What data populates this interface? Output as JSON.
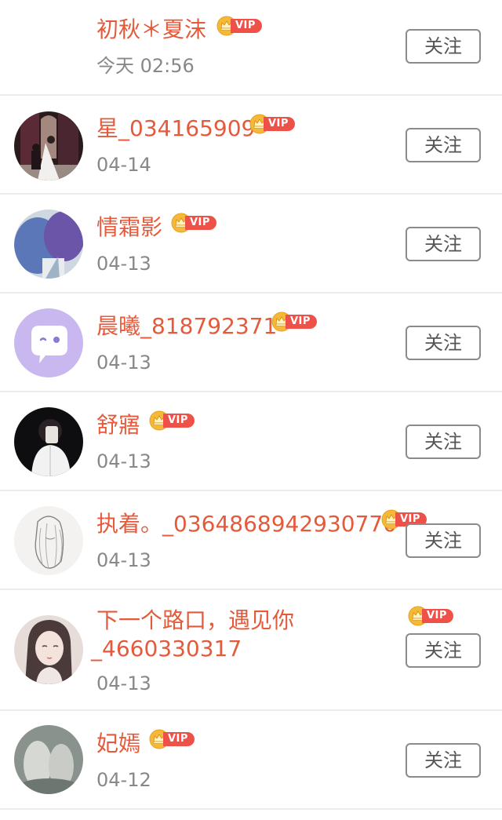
{
  "follow_label": "关注",
  "vip_label": "VIP",
  "users": [
    {
      "name": "初秋＊夏沫",
      "date": "今天 02:56"
    },
    {
      "name": "星_034165909",
      "date": "04-14"
    },
    {
      "name": "情霜影",
      "date": "04-13"
    },
    {
      "name": "晨曦_818792371",
      "date": "04-13"
    },
    {
      "name": "舒寤",
      "date": "04-13"
    },
    {
      "name": "执着。_0364868942930770",
      "date": "04-13"
    },
    {
      "name": "下一个路口，遇见你",
      "name_line2": "_4660330317",
      "date": "04-13"
    },
    {
      "name": "妃嫣",
      "date": "04-12"
    }
  ],
  "colors": {
    "name": "#e45a3b",
    "vip_badge": "#ee5148",
    "crown": "#f5b938",
    "date": "#888888",
    "button_border": "#8b8b8b"
  }
}
